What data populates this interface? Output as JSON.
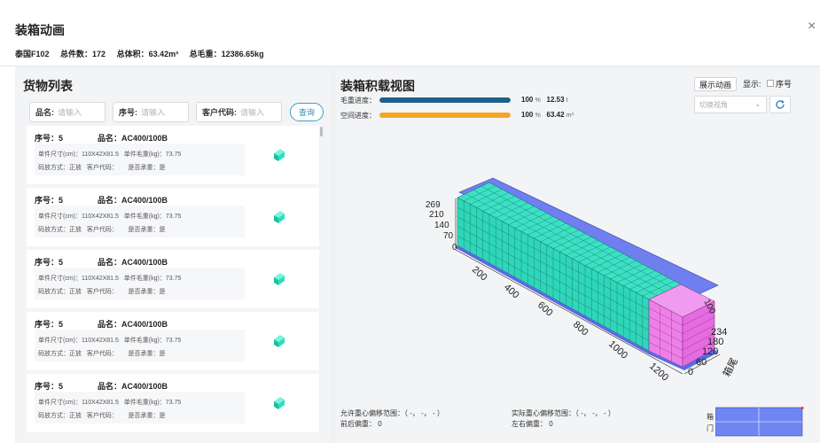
{
  "dialog": {
    "title": "装箱动画",
    "close_icon": "×"
  },
  "summary": {
    "container": "泰国F102",
    "total_pieces": "总件数：172",
    "total_volume": "总体积：63.42m³",
    "total_weight": "总毛重：12386.65kg"
  },
  "goods_list": {
    "title": "货物列表",
    "filters": {
      "name_label": "品名:",
      "name_placeholder": "请输入",
      "seq_label": "序号:",
      "seq_placeholder": "请输入",
      "customer_label": "客户代码:",
      "customer_placeholder": "请输入",
      "query_button": "查询"
    },
    "items": [
      {
        "seq": "序号：5",
        "name": "品名：AC400/100B",
        "size": "单件尺寸(cm)：110X42X81.5",
        "weight": "单件毛重(kg)：73.75",
        "stack": "码放方式：正放",
        "customer": "客户代码：",
        "reuse": "是否承重：是"
      },
      {
        "seq": "序号：5",
        "name": "品名：AC400/100B",
        "size": "单件尺寸(cm)：110X42X81.5",
        "weight": "单件毛重(kg)：73.75",
        "stack": "码放方式：正放",
        "customer": "客户代码：",
        "reuse": "是否承重：是"
      },
      {
        "seq": "序号：5",
        "name": "品名：AC400/100B",
        "size": "单件尺寸(cm)：110X42X81.5",
        "weight": "单件毛重(kg)：73.75",
        "stack": "码放方式：正放",
        "customer": "客户代码：",
        "reuse": "是否承重：是"
      },
      {
        "seq": "序号：5",
        "name": "品名：AC400/100B",
        "size": "单件尺寸(cm)：110X42X81.5",
        "weight": "单件毛重(kg)：73.75",
        "stack": "码放方式：正放",
        "customer": "客户代码：",
        "reuse": "是否承重：是"
      },
      {
        "seq": "序号：5",
        "name": "品名：AC400/100B",
        "size": "单件尺寸(cm)：110X42X81.5",
        "weight": "单件毛重(kg)：73.75",
        "stack": "码放方式：正放",
        "customer": "客户代码：",
        "reuse": "是否承重：是"
      }
    ]
  },
  "load_view": {
    "title": "装箱积载视图",
    "weight_progress": {
      "label": "毛重进度：",
      "percent": "100",
      "percent_unit": "%",
      "value": "12.53",
      "unit": "t",
      "fill": 1.0,
      "color": "#1f5f8b"
    },
    "space_progress": {
      "label": "空间进度：",
      "percent": "100",
      "percent_unit": "%",
      "value": "63.42",
      "unit": "m³",
      "fill": 1.0,
      "color": "#f5a524"
    },
    "show_animation_button": "展示动画",
    "display_label": "显示:",
    "seq_checkbox_label": "序号",
    "view_select_placeholder": "切换视角",
    "axis": {
      "height_ticks": [
        "269",
        "210",
        "140",
        "70",
        "0"
      ],
      "length_ticks": [
        "200",
        "400",
        "600",
        "800",
        "1000",
        "1200"
      ],
      "width_ticks": [
        "234",
        "180",
        "120",
        "60",
        "0"
      ],
      "width_axis_label": "箱尾",
      "end_tick": "100"
    },
    "colors": {
      "main_cargo": "#3de0c4",
      "end_cargo": "#ee7fe8",
      "container_wall": "#6f7ff0"
    },
    "allowed_cg_range": "允许重心偏移范围：（ -，  -，  - ）",
    "front_back_offset": "前后偏重： 0",
    "actual_cg_range": "实际重心偏移范围：（ -，  -，  - ）",
    "left_right_offset": "左右偏重： 0",
    "door_label_1": "箱",
    "door_label_2": "门"
  }
}
